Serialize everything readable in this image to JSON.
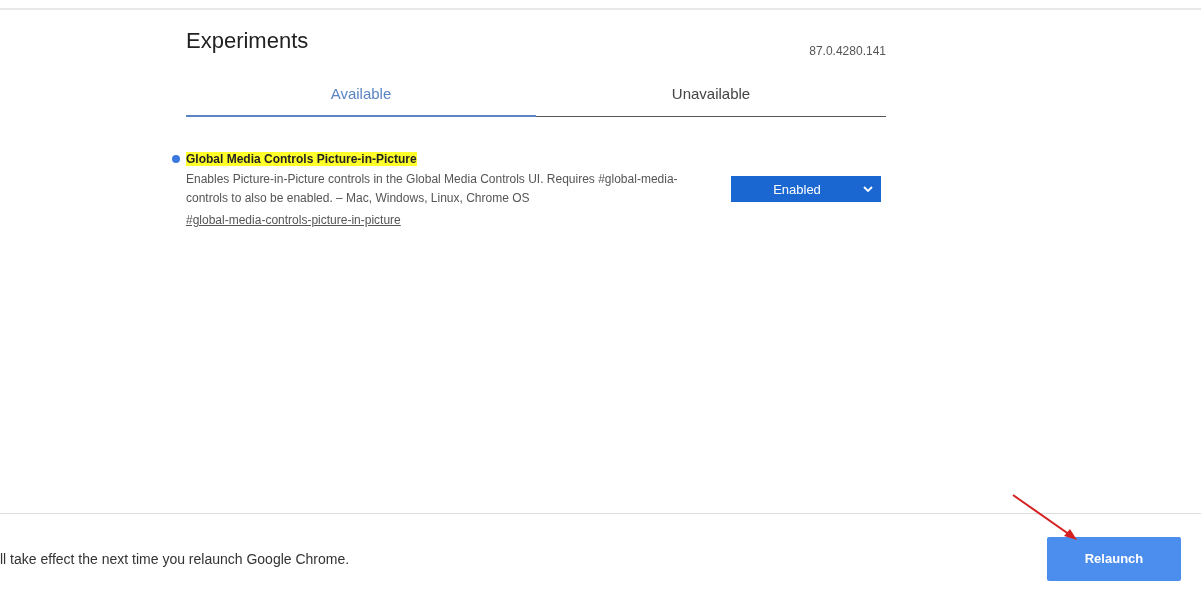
{
  "header": {
    "title": "Experiments",
    "version": "87.0.4280.141"
  },
  "tabs": [
    {
      "label": "Available",
      "selected": true
    },
    {
      "label": "Unavailable",
      "selected": false
    }
  ],
  "experiments": [
    {
      "name": "Global Media Controls Picture-in-Picture",
      "highlighted": true,
      "description": "Enables Picture-in-Picture controls in the Global Media Controls UI. Requires #global-media-controls to also be enabled. – Mac, Windows, Linux, Chrome OS",
      "link": "#global-media-controls-picture-in-picture",
      "value": "Enabled"
    }
  ],
  "footer": {
    "message": "ll take effect the next time you relaunch Google Chrome.",
    "button": "Relaunch"
  }
}
